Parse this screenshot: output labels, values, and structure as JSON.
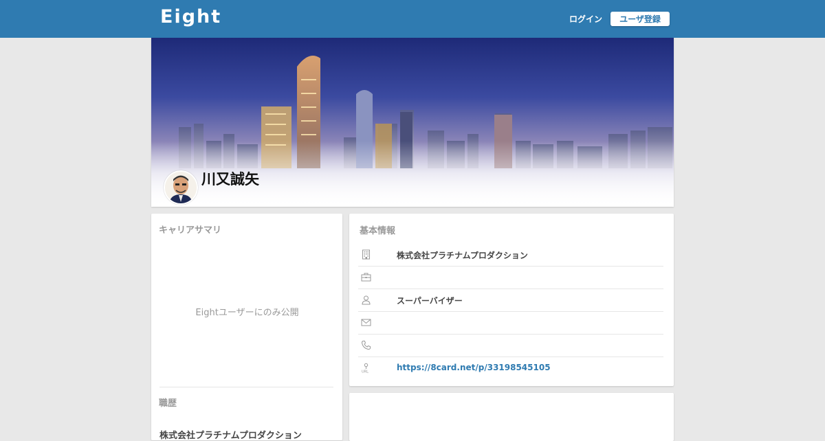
{
  "header": {
    "logo": "Eight",
    "login_label": "ログイン",
    "register_label": "ユーザ登録"
  },
  "profile": {
    "name": "川又誠矢"
  },
  "career": {
    "title": "キャリアサマリ",
    "private_note": "Eightユーザーにのみ公開",
    "history_title": "職歴",
    "history_first": "株式会社プラチナムプロダクション"
  },
  "basic_info": {
    "title": "基本情報",
    "rows": [
      {
        "icon": "building-icon",
        "value": "株式会社プラチナムプロダクション"
      },
      {
        "icon": "briefcase-icon",
        "value": ""
      },
      {
        "icon": "person-icon",
        "value": "スーパーバイザー"
      },
      {
        "icon": "mail-icon",
        "value": ""
      },
      {
        "icon": "phone-icon",
        "value": ""
      },
      {
        "icon": "url-icon",
        "value": "https://8card.net/p/33198545105"
      }
    ]
  },
  "colors": {
    "brand": "#2f7bb1",
    "background": "#e8e8e8"
  }
}
